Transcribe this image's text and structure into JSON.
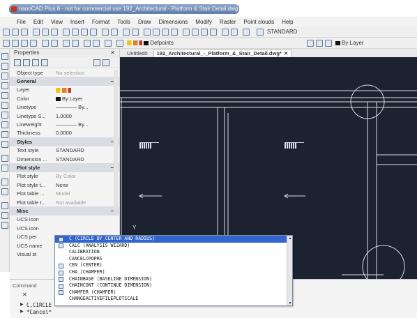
{
  "window": {
    "title": "nanoCAD Plus 8 - not for commercial use 192_Architectural - Platform & Stair Detail.dwg"
  },
  "menu": [
    "File",
    "Edit",
    "View",
    "Insert",
    "Format",
    "Tools",
    "Draw",
    "Dimensions",
    "Modify",
    "Raster",
    "Point clouds",
    "Help"
  ],
  "toolbar": {
    "text_style": "STANDARD",
    "layer": "Defpoints",
    "linetype": "By Layer"
  },
  "properties": {
    "title": "Properties",
    "close": "✕",
    "object_type_label": "Object type",
    "object_type_value": "No selection",
    "sections": {
      "general": "General",
      "styles": "Styles",
      "plot_style": "Plot style",
      "misc": "Misc"
    },
    "general": [
      {
        "k": "Layer",
        "v": ""
      },
      {
        "k": "Color",
        "v": "By Layer"
      },
      {
        "k": "Linetype",
        "v": "By..."
      },
      {
        "k": "Linetype S...",
        "v": "1.0000"
      },
      {
        "k": "Lineweight",
        "v": "By..."
      },
      {
        "k": "Thickness",
        "v": "0.0000"
      }
    ],
    "styles": [
      {
        "k": "Text style",
        "v": "STANDARD"
      },
      {
        "k": "Dimension ...",
        "v": "STANDARD"
      }
    ],
    "plot": [
      {
        "k": "Plot style",
        "v": "By Color"
      },
      {
        "k": "Plot style t...",
        "v": "None"
      },
      {
        "k": "Plot table ...",
        "v": "Model"
      },
      {
        "k": "Plot table t...",
        "v": "Not available"
      }
    ],
    "misc": [
      {
        "k": "UCS icon"
      },
      {
        "k": "UCS icon"
      },
      {
        "k": "UCS per"
      },
      {
        "k": "UCS name"
      },
      {
        "k": "Visual st"
      }
    ]
  },
  "tabs": {
    "untitled": "Untitled0",
    "active": "192_Architectural_-_Platform_&_Stair_Detail.dwg*",
    "close": "✕"
  },
  "canvas": {
    "axis_y": "Y"
  },
  "autocomplete": [
    "C (CIRCLE BY CENTER AND RADIUS)",
    "CALC (ANALYSIS WIZARD)",
    "CALIBRATION",
    "CANCELCPOPRS",
    "CEN (CENTER)",
    "CHA (CHAMFER)",
    "CHAINBASE (BASELINE DIMENSION)",
    "CHAINCONT (CONTINUE DIMENSION)",
    "CHAMFER (CHAMFER)",
    "CHANGEACTIVEFILEPLOTSCALE"
  ],
  "command": {
    "label": "Command",
    "history_1": "C,CIRCLE",
    "history_2": "*Cancel*",
    "close": "✕"
  },
  "colors": {
    "canvas_bg": "#1d2230",
    "selection": "#3366cc",
    "line": "#d9dde3"
  }
}
